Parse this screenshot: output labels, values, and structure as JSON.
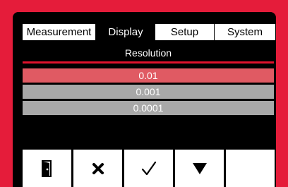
{
  "tabs": [
    {
      "label": "Measurement",
      "active": false
    },
    {
      "label": "Display",
      "active": true
    },
    {
      "label": "Setup",
      "active": false
    },
    {
      "label": "System",
      "active": false
    }
  ],
  "screen_title": "Resolution",
  "options": [
    {
      "label": "0.01",
      "selected": true
    },
    {
      "label": "0.001",
      "selected": false
    },
    {
      "label": "0.0001",
      "selected": false
    }
  ],
  "softkeys": [
    {
      "icon": "exit-door-icon"
    },
    {
      "icon": "cancel-x-icon"
    },
    {
      "icon": "confirm-check-icon"
    },
    {
      "icon": "down-arrow-icon"
    },
    {
      "icon": ""
    }
  ],
  "colors": {
    "bezel": "#e51c3a",
    "selected_row": "#e05a63",
    "unselected_row": "#a8a8a8",
    "title_rule": "#e0132d"
  }
}
